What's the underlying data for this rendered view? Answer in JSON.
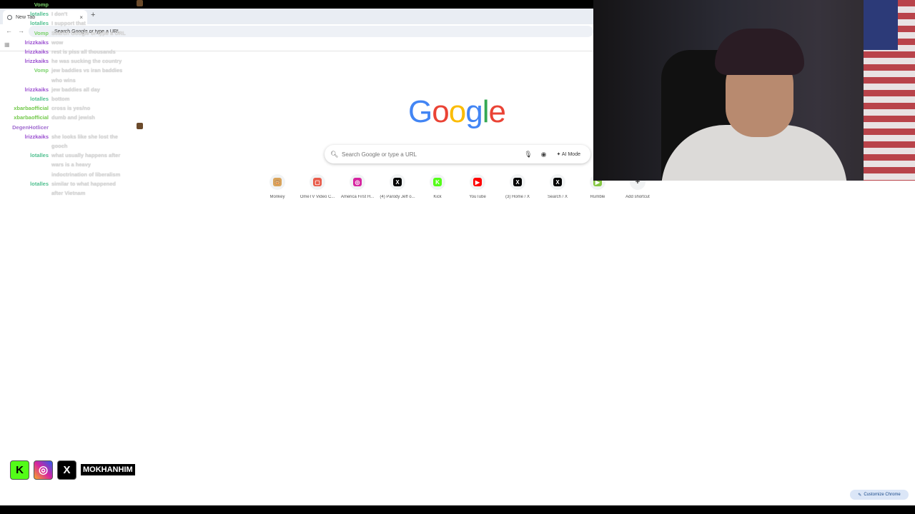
{
  "browser": {
    "tab_title": "New Tab",
    "newtab_symbol": "+",
    "close_symbol": "×",
    "omnibox_placeholder": "Search Google or type a URL"
  },
  "google": {
    "logo_text": "Google",
    "search_placeholder": "Search Google or type a URL",
    "ai_mode_label": "AI Mode",
    "shortcuts": [
      {
        "label": "Monkey",
        "color": "#d9a35a",
        "glyph": "🐵"
      },
      {
        "label": "OmeTV Video C...",
        "color": "#e85b4a",
        "glyph": "▢"
      },
      {
        "label": "America First H...",
        "color": "#d6249f",
        "glyph": "◎"
      },
      {
        "label": "(4) Parody Jeff o...",
        "color": "#000000",
        "glyph": "X"
      },
      {
        "label": "Kick",
        "color": "#53fc18",
        "glyph": "K"
      },
      {
        "label": "YouTube",
        "color": "#ff0000",
        "glyph": "▶"
      },
      {
        "label": "(3) Home / X",
        "color": "#000000",
        "glyph": "X"
      },
      {
        "label": "Search / X",
        "color": "#000000",
        "glyph": "X"
      },
      {
        "label": "Rumble",
        "color": "#85c742",
        "glyph": "▶"
      },
      {
        "label": "Add shortcut",
        "color": "#f1f3f4",
        "glyph": "+"
      }
    ],
    "customize_label": "Customize Chrome"
  },
  "chat": [
    {
      "user": "Vomp",
      "color": "#7ad26b",
      "msg": "",
      "emote": true
    },
    {
      "user": "lotalles",
      "color": "#4fbf8f",
      "msg": "I don't"
    },
    {
      "user": "lotalles",
      "color": "#4fbf8f",
      "msg": "I support that"
    },
    {
      "user": "Vomp",
      "color": "#7ad26b",
      "msg": "Search Google or type a URL"
    },
    {
      "user": "lrizzkaiks",
      "color": "#9b4fd0",
      "msg": "wow"
    },
    {
      "user": "lrizzkaiks",
      "color": "#9b4fd0",
      "msg": "rest is piss all thousands"
    },
    {
      "user": "lrizzkaiks",
      "color": "#9b4fd0",
      "msg": "he was sucking the country"
    },
    {
      "user": "Vomp",
      "color": "#7ad26b",
      "msg": "jew baddies vs iran baddies"
    },
    {
      "user": "",
      "color": "#7ad26b",
      "msg": "who wins"
    },
    {
      "user": "lrizzkaiks",
      "color": "#9b4fd0",
      "msg": "jew baddies all day"
    },
    {
      "user": "lotalles",
      "color": "#4fbf8f",
      "msg": "bottom"
    },
    {
      "user": "xbarbaofficial",
      "color": "#72c94a",
      "msg": "cross is yes/no"
    },
    {
      "user": "xbarbaofficial",
      "color": "#72c94a",
      "msg": "dumb and jewish"
    },
    {
      "user": "DegenHotlicer",
      "color": "#a06bd0",
      "msg": "",
      "emote": true
    },
    {
      "user": "lrizzkaiks",
      "color": "#9b4fd0",
      "msg": "she looks like she lost the"
    },
    {
      "user": "",
      "color": "#9b4fd0",
      "msg": "gooch"
    },
    {
      "user": "lotalles",
      "color": "#4fbf8f",
      "msg": "what usually happens after"
    },
    {
      "user": "",
      "color": "#4fbf8f",
      "msg": "wars is a heavy"
    },
    {
      "user": "",
      "color": "#4fbf8f",
      "msg": "indoctrination of liberalism"
    },
    {
      "user": "lotalles",
      "color": "#4fbf8f",
      "msg": "similar to what happened"
    },
    {
      "user": "",
      "color": "#4fbf8f",
      "msg": "after Vietnam"
    }
  ],
  "social": {
    "handle": "MOKHANHIM",
    "kick_glyph": "K",
    "instagram_glyph": "◎",
    "x_glyph": "X"
  },
  "colors": {
    "google_blue": "#4285F4",
    "google_red": "#EA4335",
    "google_yellow": "#FBBC05",
    "google_green": "#34A853"
  }
}
